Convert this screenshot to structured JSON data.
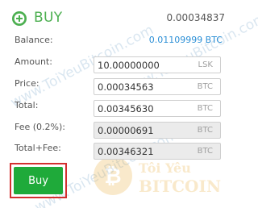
{
  "header": {
    "title": "BUY",
    "price": "0.00034837"
  },
  "balance": {
    "label": "Balance:",
    "value": "0.01109999 BTC"
  },
  "fields": [
    {
      "label": "Amount:",
      "value": "10.00000000",
      "unit": "LSK",
      "readonly": false
    },
    {
      "label": "Price:",
      "value": "0.00034563",
      "unit": "BTC",
      "readonly": false
    },
    {
      "label": "Total:",
      "value": "0.00345630",
      "unit": "BTC",
      "readonly": false
    },
    {
      "label": "Fee (0.2%):",
      "value": "0.00000691",
      "unit": "BTC",
      "readonly": true
    },
    {
      "label": "Total+Fee:",
      "value": "0.00346321",
      "unit": "BTC",
      "readonly": true
    }
  ],
  "actions": {
    "buy_label": "Buy"
  },
  "watermark": {
    "text": "www.ToiYeuBitcoin.com",
    "logo_text": "Tôi Yêu BITCOIN"
  },
  "colors": {
    "accent": "#4caf50",
    "button": "#1faa3a",
    "highlight_border": "#d32f2f",
    "balance": "#2b8fd6"
  },
  "icons": {
    "header": "plus-circle-icon"
  }
}
